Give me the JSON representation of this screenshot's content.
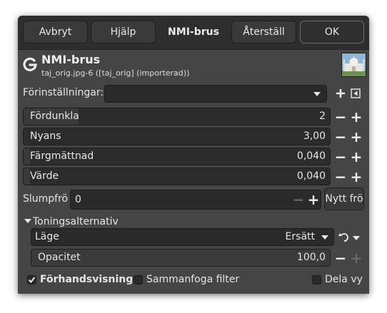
{
  "titlebar": {
    "cancel_label": "Avbryt",
    "help_label": "Hjälp",
    "title": "NMI-brus",
    "reset_label": "Återställ",
    "ok_label": "OK"
  },
  "header": {
    "title": "NMI-brus",
    "subtitle": "taj_orig.jpg-6 ([taj_orig] (importerad))"
  },
  "presets": {
    "label": "Förinställningar:",
    "value": ""
  },
  "sliders": [
    {
      "label": "Fördunkla",
      "value": "2",
      "fill_fraction": 0.18
    },
    {
      "label": "Nyans",
      "value": "3,00",
      "fill_fraction": 0.0
    },
    {
      "label": "Färgmättnad",
      "value": "0,040",
      "fill_fraction": 0.02
    },
    {
      "label": "Värde",
      "value": "0,040",
      "fill_fraction": 0.02
    }
  ],
  "seed": {
    "label": "Slumpfrö",
    "value": "0",
    "new_seed_label": "Nytt frö"
  },
  "blending": {
    "section_label": "Toningsalternativ",
    "mode_label": "Läge",
    "mode_value": "Ersätt",
    "opacity_label": "Opacitet",
    "opacity_value": "100,0",
    "opacity_fill_fraction": 1.0
  },
  "footer": {
    "preview_label": "Förhandsvisning",
    "preview_checked": true,
    "merge_label": "Sammanfoga filter",
    "merge_checked": false,
    "split_label": "Dela vy",
    "split_checked": false
  },
  "colors": {
    "dialog_bg": "#454545",
    "titlebar_bg": "#2e2e2e",
    "field_bg": "#2a2a2a",
    "text": "#e6e6e6"
  }
}
